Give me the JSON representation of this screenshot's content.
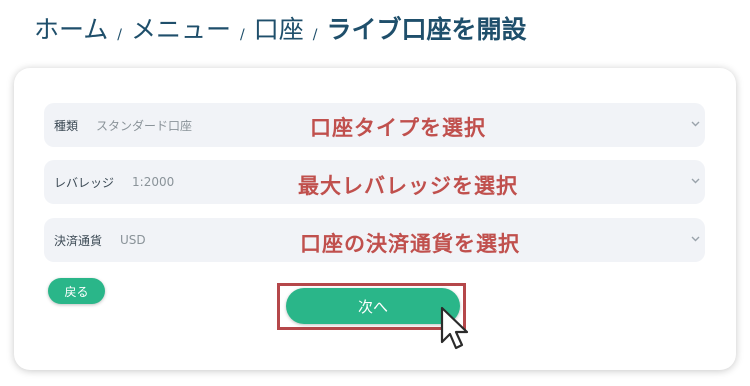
{
  "breadcrumb": {
    "items": [
      "ホーム",
      "メニュー",
      "口座"
    ],
    "separator": "/",
    "current": "ライブ口座を開設"
  },
  "form": {
    "fields": [
      {
        "label": "種類",
        "value": "スタンダード口座",
        "annotation": "口座タイプを選択"
      },
      {
        "label": "レバレッジ",
        "value": "1:2000",
        "annotation": "最大レバレッジを選択"
      },
      {
        "label": "決済通貨",
        "value": "USD",
        "annotation": "口座の決済通貨を選択"
      }
    ],
    "back_label": "戻る",
    "next_label": "次へ"
  },
  "icons": {
    "select_chevron": "chevron-down-icon",
    "pointer": "mouse-pointer-icon"
  },
  "colors": {
    "primary": "#2ab689",
    "annotation": "#c0504d",
    "heading": "#1f4f6b",
    "field_bg": "#f1f3f7"
  }
}
